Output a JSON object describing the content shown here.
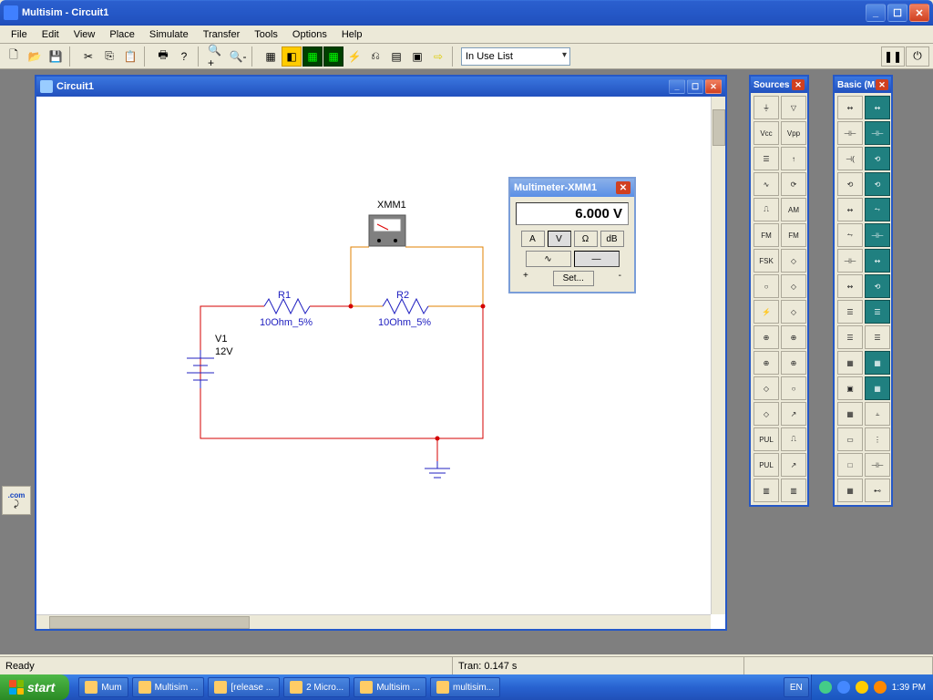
{
  "app": {
    "title": "Multisim - Circuit1"
  },
  "menu": [
    "File",
    "Edit",
    "View",
    "Place",
    "Simulate",
    "Transfer",
    "Tools",
    "Options",
    "Help"
  ],
  "toolbar": {
    "inuse_label": "In Use List"
  },
  "circuit_window": {
    "title": "Circuit1"
  },
  "circuit": {
    "xmm1_label": "XMM1",
    "r1_label": "R1",
    "r1_value": "10Ohm_5%",
    "r2_label": "R2",
    "r2_value": "10Ohm_5%",
    "v1_label": "V1",
    "v1_value": "12V"
  },
  "multimeter": {
    "title": "Multimeter-XMM1",
    "display": "6.000  V",
    "btn_a": "A",
    "btn_v": "V",
    "btn_ohm": "Ω",
    "btn_db": "dB",
    "btn_ac": "∿",
    "btn_dc": "—",
    "btn_set": "Set...",
    "term_plus": "+",
    "term_minus": "-"
  },
  "palettes": {
    "sources_title": "Sources ...",
    "basic_title": "Basic (M..."
  },
  "sources_cells": [
    "⏚",
    "▽",
    "Vcc",
    "Vpp",
    "☰",
    "↑",
    "∿",
    "⟳",
    "⎍",
    "AM",
    "FM",
    "FM",
    "FSK",
    "◇",
    "○",
    "◇",
    "⚡",
    "◇",
    "⊕",
    "⊕",
    "⊕",
    "⊕",
    "◇",
    "○",
    "◇",
    "↗",
    "PUL",
    "⎍",
    "PUL",
    "↗",
    "▥",
    "▥"
  ],
  "basic_cells": [
    "↭",
    "↭",
    "⊣⊢",
    "⊣⊢",
    "⊣(",
    "⟲",
    "⟲",
    "⟲",
    "↭",
    "⥊",
    "⥊",
    "⊣⊢",
    "⊣⊢",
    "↭",
    "↭",
    "⟲",
    "☰",
    "☰",
    "☰",
    "☰",
    "▦",
    "▦",
    "▣",
    "▦",
    "▦",
    "⫠",
    "▭",
    "⋮",
    "□",
    "⊣⊢",
    "▦",
    "⊷"
  ],
  "basic_teal": [
    1,
    3,
    5,
    7,
    9,
    11,
    13,
    15,
    17,
    21,
    23
  ],
  "status": {
    "ready": "Ready",
    "tran": "Tran: 0.147 s"
  },
  "taskbar": {
    "start": "start",
    "lang": "EN",
    "time": "1:39 PM",
    "items": [
      "Mum",
      "Multisim ...",
      "[release ...",
      "2 Micro...",
      "Multisim ...",
      "multisim..."
    ]
  },
  "left_tool": ".com"
}
